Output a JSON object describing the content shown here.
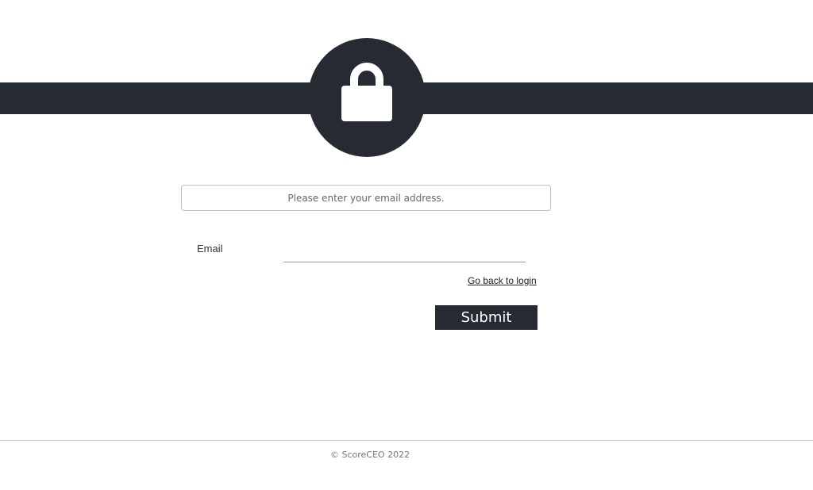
{
  "header": {
    "lock_icon": "lock-icon",
    "band_color": "#262b33"
  },
  "notice": {
    "text": "Please enter your email address."
  },
  "form": {
    "email_label": "Email",
    "email_value": "",
    "email_placeholder": "",
    "back_link": "Go back to login",
    "submit_label": "Submit"
  },
  "footer": {
    "copyright": "© ScoreCEO 2022"
  }
}
